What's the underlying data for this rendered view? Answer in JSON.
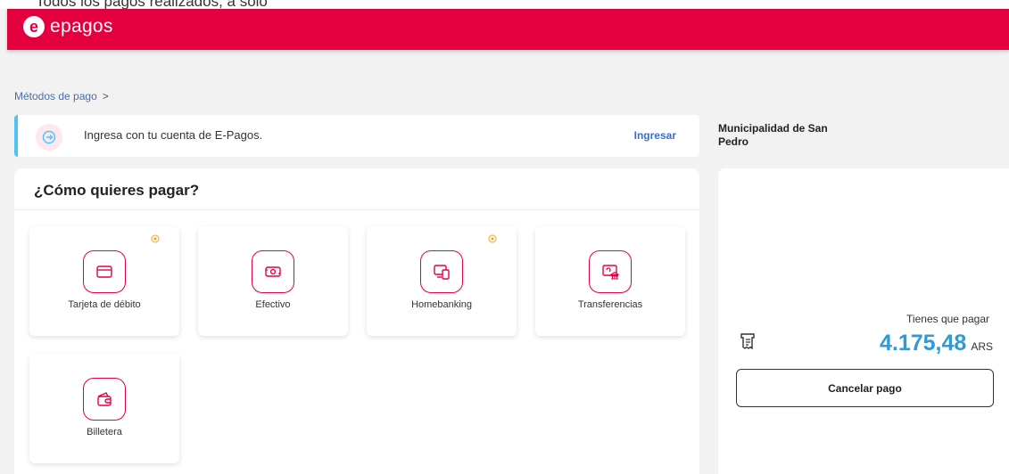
{
  "top_strip": {
    "text": "Todos los pagos realizados, a solo"
  },
  "header": {
    "logo_mark": "e",
    "logo_text": "epagos"
  },
  "breadcrumb": {
    "item": "Métodos de pago",
    "separator": ">"
  },
  "login_bar": {
    "message": "Ingresa con tu cuenta de E-Pagos.",
    "link_label": "Ingresar",
    "accent_color": "#4fc3f7"
  },
  "payment": {
    "title": "¿Cómo quieres pagar?",
    "methods": [
      {
        "label": "Tarjeta de débito",
        "icon": "card-icon",
        "badge": true
      },
      {
        "label": "Efectivo",
        "icon": "cash-icon",
        "badge": false
      },
      {
        "label": "Homebanking",
        "icon": "devices-icon",
        "badge": true
      },
      {
        "label": "Transferencias",
        "icon": "bank-transfer-icon",
        "badge": false
      },
      {
        "label": "Billetera",
        "icon": "wallet-icon",
        "badge": false
      }
    ]
  },
  "summary": {
    "merchant": "Municipalidad de San Pedro",
    "due_label": "Tienes que pagar",
    "amount": "4.175,48",
    "currency": "ARS",
    "cancel_label": "Cancelar pago"
  },
  "colors": {
    "brand": "#e4003f",
    "amount": "#2f9ad6",
    "link": "#3d6fc5"
  }
}
